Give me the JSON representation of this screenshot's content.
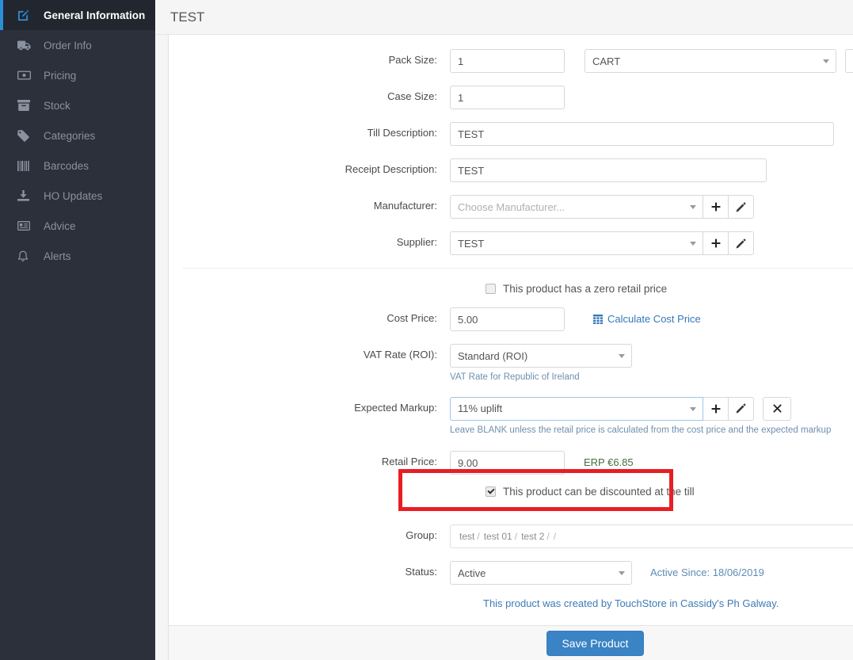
{
  "sidebar": {
    "items": [
      {
        "label": "General Information",
        "icon": "edit-square-icon",
        "active": true
      },
      {
        "label": "Order Info",
        "icon": "truck-icon",
        "active": false
      },
      {
        "label": "Pricing",
        "icon": "money-bill-icon",
        "active": false
      },
      {
        "label": "Stock",
        "icon": "archive-box-icon",
        "active": false
      },
      {
        "label": "Categories",
        "icon": "tag-icon",
        "active": false
      },
      {
        "label": "Barcodes",
        "icon": "barcode-icon",
        "active": false
      },
      {
        "label": "HO Updates",
        "icon": "download-icon",
        "active": false
      },
      {
        "label": "Advice",
        "icon": "news-card-icon",
        "active": false
      },
      {
        "label": "Alerts",
        "icon": "bell-icon",
        "active": false
      }
    ]
  },
  "header": {
    "title": "TEST"
  },
  "form": {
    "pack_size": {
      "label": "Pack Size:",
      "value": "1",
      "unit_value": "CART",
      "clear_label": "✖"
    },
    "case_size": {
      "label": "Case Size:",
      "value": "1"
    },
    "till_description": {
      "label": "Till Description:",
      "value": "TEST"
    },
    "receipt_description": {
      "label": "Receipt Description:",
      "value": "TEST"
    },
    "manufacturer": {
      "label": "Manufacturer:",
      "value": "",
      "placeholder": "Choose Manufacturer...",
      "add_label": "＋",
      "edit_label": "edit"
    },
    "supplier": {
      "label": "Supplier:",
      "value": "TEST",
      "add_label": "＋",
      "edit_label": "edit"
    },
    "zero_retail_price": {
      "label": "This product has a zero retail price",
      "checked": false
    },
    "cost_price": {
      "label": "Cost Price:",
      "value": "5.00"
    },
    "calculate_cost_price": {
      "label": "Calculate Cost Price"
    },
    "vat_rate": {
      "label": "VAT Rate (ROI):",
      "value": "Standard (ROI)",
      "hint": "VAT Rate for Republic of Ireland"
    },
    "expected_markup": {
      "label": "Expected Markup:",
      "value": "11% uplift",
      "hint": "Leave BLANK unless the retail price is calculated from the cost price and the expected markup",
      "clear_label": "✖"
    },
    "retail_price": {
      "label": "Retail Price:",
      "value": "9.00",
      "erp": "ERP €6.85"
    },
    "discountable": {
      "label": "This product can be discounted at the till",
      "checked": true
    },
    "group": {
      "label": "Group:",
      "segments": [
        "test",
        "test 01",
        "test 2",
        ""
      ],
      "separator": "/",
      "clear_label": "✖",
      "edit_label": "edit"
    },
    "status": {
      "label": "Status:",
      "value": "Active",
      "active_since": "Active Since: 18/06/2019"
    },
    "created_note": "This product was created by TouchStore in Cassidy's Ph Galway."
  },
  "footer": {
    "save_label": "Save Product"
  },
  "colors": {
    "sidebar_bg": "#2b303b",
    "sidebar_active_bg": "#22262f",
    "accent_blue": "#2b8fd8",
    "link_blue": "#3678b8",
    "highlight_red": "#e81e22",
    "primary_button": "#3a83c4",
    "erp_green": "#4a6b46"
  }
}
